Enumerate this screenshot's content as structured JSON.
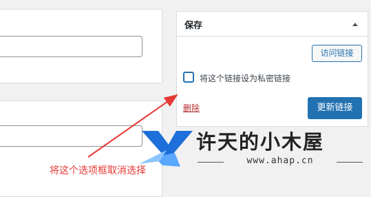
{
  "save_box": {
    "title": "保存",
    "visit_link_button": "访问链接",
    "private_checkbox_label": "将这个链接设为私密链接",
    "private_checked": false,
    "delete_link": "删除",
    "update_button": "更新链接"
  },
  "annotation": {
    "text": "将这个选项框取消选择",
    "color": "#e53935"
  },
  "watermark": {
    "title": "许天的小木屋",
    "url": "www.ahap.cn",
    "logo_icon": "x-logo-icon"
  },
  "colors": {
    "primary": "#2271b1",
    "danger": "#b32d2e",
    "background": "#f1f1f1"
  }
}
